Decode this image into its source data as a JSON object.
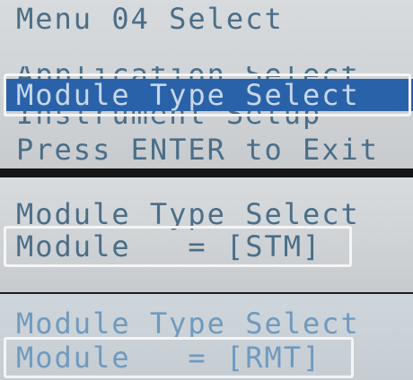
{
  "panel1": {
    "title": "Menu 04 Select",
    "items": [
      "Application Select",
      "Module Type Select",
      "Instrument Setup"
    ],
    "highlighted_index": 1,
    "footer": "Press ENTER to Exit"
  },
  "panel2": {
    "title": "Module Type Select",
    "field": "Module   = [STM]"
  },
  "panel3": {
    "title": "Module Type Select",
    "field": "Module   = [RMT]"
  },
  "colors": {
    "lcd_text": "#4b6e88",
    "highlight": "#2a62a9",
    "frame": "#f5f5f5",
    "divider": "#e8241a"
  }
}
